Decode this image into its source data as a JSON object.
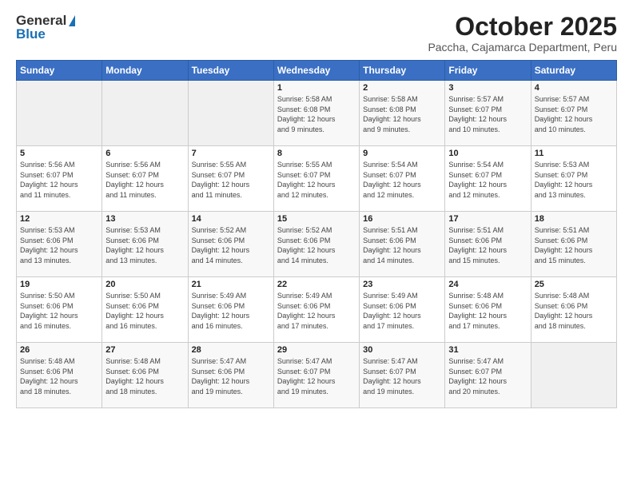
{
  "header": {
    "logo_general": "General",
    "logo_blue": "Blue",
    "title": "October 2025",
    "location": "Paccha, Cajamarca Department, Peru"
  },
  "days_of_week": [
    "Sunday",
    "Monday",
    "Tuesday",
    "Wednesday",
    "Thursday",
    "Friday",
    "Saturday"
  ],
  "weeks": [
    [
      {
        "day": "",
        "info": ""
      },
      {
        "day": "",
        "info": ""
      },
      {
        "day": "",
        "info": ""
      },
      {
        "day": "1",
        "info": "Sunrise: 5:58 AM\nSunset: 6:08 PM\nDaylight: 12 hours\nand 9 minutes."
      },
      {
        "day": "2",
        "info": "Sunrise: 5:58 AM\nSunset: 6:08 PM\nDaylight: 12 hours\nand 9 minutes."
      },
      {
        "day": "3",
        "info": "Sunrise: 5:57 AM\nSunset: 6:07 PM\nDaylight: 12 hours\nand 10 minutes."
      },
      {
        "day": "4",
        "info": "Sunrise: 5:57 AM\nSunset: 6:07 PM\nDaylight: 12 hours\nand 10 minutes."
      }
    ],
    [
      {
        "day": "5",
        "info": "Sunrise: 5:56 AM\nSunset: 6:07 PM\nDaylight: 12 hours\nand 11 minutes."
      },
      {
        "day": "6",
        "info": "Sunrise: 5:56 AM\nSunset: 6:07 PM\nDaylight: 12 hours\nand 11 minutes."
      },
      {
        "day": "7",
        "info": "Sunrise: 5:55 AM\nSunset: 6:07 PM\nDaylight: 12 hours\nand 11 minutes."
      },
      {
        "day": "8",
        "info": "Sunrise: 5:55 AM\nSunset: 6:07 PM\nDaylight: 12 hours\nand 12 minutes."
      },
      {
        "day": "9",
        "info": "Sunrise: 5:54 AM\nSunset: 6:07 PM\nDaylight: 12 hours\nand 12 minutes."
      },
      {
        "day": "10",
        "info": "Sunrise: 5:54 AM\nSunset: 6:07 PM\nDaylight: 12 hours\nand 12 minutes."
      },
      {
        "day": "11",
        "info": "Sunrise: 5:53 AM\nSunset: 6:07 PM\nDaylight: 12 hours\nand 13 minutes."
      }
    ],
    [
      {
        "day": "12",
        "info": "Sunrise: 5:53 AM\nSunset: 6:06 PM\nDaylight: 12 hours\nand 13 minutes."
      },
      {
        "day": "13",
        "info": "Sunrise: 5:53 AM\nSunset: 6:06 PM\nDaylight: 12 hours\nand 13 minutes."
      },
      {
        "day": "14",
        "info": "Sunrise: 5:52 AM\nSunset: 6:06 PM\nDaylight: 12 hours\nand 14 minutes."
      },
      {
        "day": "15",
        "info": "Sunrise: 5:52 AM\nSunset: 6:06 PM\nDaylight: 12 hours\nand 14 minutes."
      },
      {
        "day": "16",
        "info": "Sunrise: 5:51 AM\nSunset: 6:06 PM\nDaylight: 12 hours\nand 14 minutes."
      },
      {
        "day": "17",
        "info": "Sunrise: 5:51 AM\nSunset: 6:06 PM\nDaylight: 12 hours\nand 15 minutes."
      },
      {
        "day": "18",
        "info": "Sunrise: 5:51 AM\nSunset: 6:06 PM\nDaylight: 12 hours\nand 15 minutes."
      }
    ],
    [
      {
        "day": "19",
        "info": "Sunrise: 5:50 AM\nSunset: 6:06 PM\nDaylight: 12 hours\nand 16 minutes."
      },
      {
        "day": "20",
        "info": "Sunrise: 5:50 AM\nSunset: 6:06 PM\nDaylight: 12 hours\nand 16 minutes."
      },
      {
        "day": "21",
        "info": "Sunrise: 5:49 AM\nSunset: 6:06 PM\nDaylight: 12 hours\nand 16 minutes."
      },
      {
        "day": "22",
        "info": "Sunrise: 5:49 AM\nSunset: 6:06 PM\nDaylight: 12 hours\nand 17 minutes."
      },
      {
        "day": "23",
        "info": "Sunrise: 5:49 AM\nSunset: 6:06 PM\nDaylight: 12 hours\nand 17 minutes."
      },
      {
        "day": "24",
        "info": "Sunrise: 5:48 AM\nSunset: 6:06 PM\nDaylight: 12 hours\nand 17 minutes."
      },
      {
        "day": "25",
        "info": "Sunrise: 5:48 AM\nSunset: 6:06 PM\nDaylight: 12 hours\nand 18 minutes."
      }
    ],
    [
      {
        "day": "26",
        "info": "Sunrise: 5:48 AM\nSunset: 6:06 PM\nDaylight: 12 hours\nand 18 minutes."
      },
      {
        "day": "27",
        "info": "Sunrise: 5:48 AM\nSunset: 6:06 PM\nDaylight: 12 hours\nand 18 minutes."
      },
      {
        "day": "28",
        "info": "Sunrise: 5:47 AM\nSunset: 6:06 PM\nDaylight: 12 hours\nand 19 minutes."
      },
      {
        "day": "29",
        "info": "Sunrise: 5:47 AM\nSunset: 6:07 PM\nDaylight: 12 hours\nand 19 minutes."
      },
      {
        "day": "30",
        "info": "Sunrise: 5:47 AM\nSunset: 6:07 PM\nDaylight: 12 hours\nand 19 minutes."
      },
      {
        "day": "31",
        "info": "Sunrise: 5:47 AM\nSunset: 6:07 PM\nDaylight: 12 hours\nand 20 minutes."
      },
      {
        "day": "",
        "info": ""
      }
    ]
  ]
}
